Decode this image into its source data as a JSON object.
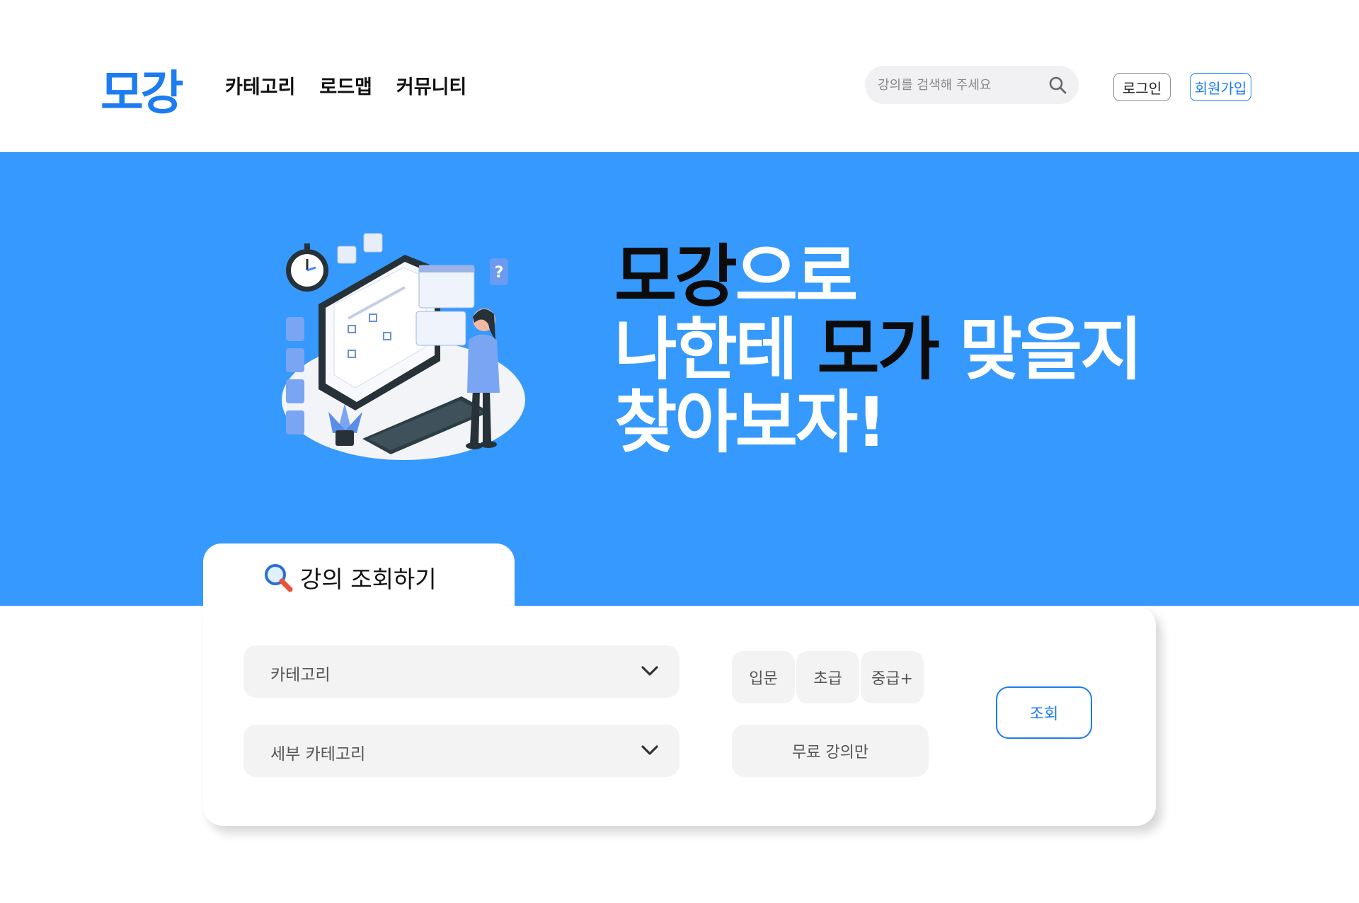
{
  "header": {
    "logo": "모강",
    "nav": [
      "카테고리",
      "로드맵",
      "커뮤니티"
    ],
    "search_placeholder": "강의를 검색해 주세요",
    "login_label": "로그인",
    "signup_label": "회원가입"
  },
  "hero": {
    "line1_dark": "모강",
    "line1_light": "으로",
    "line2_light_a": "나한테 ",
    "line2_dark": "모가",
    "line2_light_b": " 맞을지",
    "line3": "찾아보자!"
  },
  "search_panel": {
    "tab_title": "강의 조회하기",
    "category_placeholder": "카테고리",
    "subcategory_placeholder": "세부 카테고리",
    "levels": [
      "입문",
      "초급",
      "중급+"
    ],
    "free_only_label": "무료 강의만",
    "query_button_label": "조회"
  },
  "colors": {
    "brand": "#1d7cf2",
    "hero_bg": "#3599fd",
    "chip_bg": "#f3f3f3"
  },
  "icons": {
    "search": "search-icon",
    "tab": "magnifier-icon",
    "dropdown": "chevron-down-icon"
  }
}
